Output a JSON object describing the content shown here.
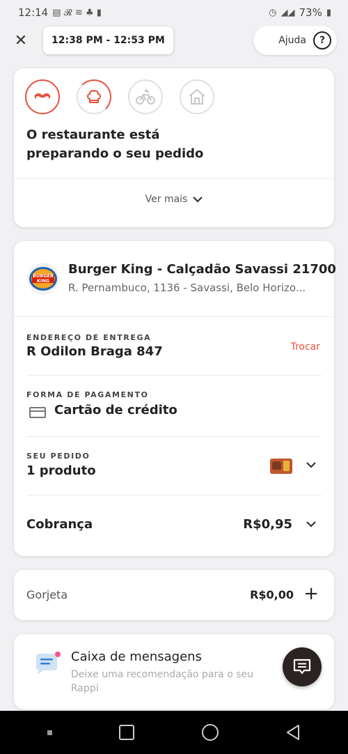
{
  "status_bar": {
    "time": "12:14",
    "battery": "73%"
  },
  "header": {
    "close_label": "✕",
    "time_window": "12:38 PM - 12:53 PM",
    "help_label": "Ajuda",
    "help_icon": "?"
  },
  "order_status": {
    "steps": [
      "mustache-icon",
      "chef-hat-icon",
      "bike-icon",
      "home-icon"
    ],
    "active_step": 1,
    "message": "O restaurante está preparando o seu pedido",
    "see_more_label": "Ver mais"
  },
  "store": {
    "logo_text": "BURGER KING",
    "name": "Burger King - Calçadão Savassi 21700",
    "address": "R. Pernambuco, 1136 - Savassi, Belo Horizo..."
  },
  "delivery": {
    "label": "ENDEREÇO DE ENTREGA",
    "address": "R Odilon Braga 847",
    "change_label": "Trocar"
  },
  "payment": {
    "label": "FORMA DE PAGAMENTO",
    "method": "Cartão de crédito"
  },
  "order": {
    "label": "SEU PEDIDO",
    "items": "1 produto"
  },
  "charge": {
    "label": "Cobrança",
    "value": "R$0,95"
  },
  "tip": {
    "label": "Gorjeta",
    "value": "R$0,00",
    "add_label": "+"
  },
  "messages": {
    "title": "Caixa de mensagens",
    "subtitle": "Deixe uma recomendação para o seu Rappi"
  },
  "colors": {
    "accent": "#e8513e",
    "background": "#f1f1f3",
    "fab": "#2b2321"
  }
}
